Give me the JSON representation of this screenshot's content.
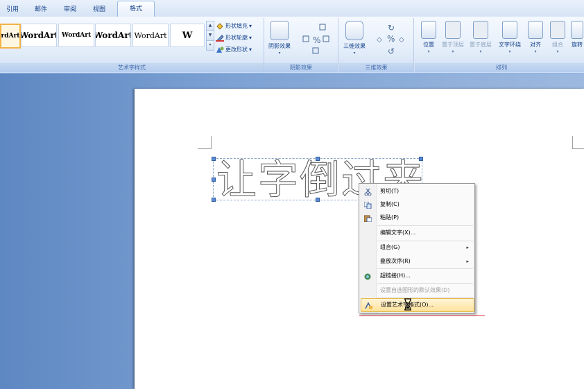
{
  "tabs": [
    {
      "label": "引用"
    },
    {
      "label": "邮件"
    },
    {
      "label": "审阅"
    },
    {
      "label": "视图"
    },
    {
      "label": "格式"
    }
  ],
  "ribbon": {
    "wordart_styles": {
      "swatches": [
        "rdArt",
        "WordArt",
        "WordArt",
        "WordArt",
        "WordArt",
        "W"
      ],
      "commands": [
        {
          "label": "形状填充",
          "arrow": "▾"
        },
        {
          "label": "形状轮廓",
          "arrow": "▾"
        },
        {
          "label": "更改形状",
          "arrow": "▾"
        }
      ],
      "group_label": "艺术字样式"
    },
    "shadow": {
      "button_label": "阴影效果",
      "group_label": "阴影效果"
    },
    "threed": {
      "button_label": "三维效果",
      "group_label": "三维效果"
    },
    "arrange": {
      "buttons": [
        {
          "label": "位置"
        },
        {
          "label": "置于顶层"
        },
        {
          "label": "置于底层"
        },
        {
          "label": "文字环绕"
        },
        {
          "label": "对齐"
        },
        {
          "label": "组合"
        },
        {
          "label": "旋转"
        }
      ],
      "group_label": "排列"
    }
  },
  "document": {
    "wordart_text": "让字倒过来"
  },
  "context_menu": {
    "items": [
      {
        "label": "剪切(T)",
        "icon": "scissors-icon",
        "disabled": false
      },
      {
        "label": "复制(C)",
        "icon": "copy-icon",
        "disabled": false
      },
      {
        "label": "粘贴(P)",
        "icon": "paste-icon",
        "disabled": false
      },
      {
        "label": "编辑文字(X)...",
        "icon": "",
        "disabled": false
      },
      {
        "label": "组合(G)",
        "icon": "",
        "disabled": false,
        "submenu": "▸"
      },
      {
        "label": "叠放次序(R)",
        "icon": "",
        "disabled": false,
        "submenu": "▸"
      },
      {
        "label": "超链接(H)...",
        "icon": "hyperlink-icon",
        "disabled": false
      },
      {
        "label": "设置自选图形的默认效果(D)",
        "icon": "",
        "disabled": true
      },
      {
        "label": "设置艺术字格式(O)...",
        "icon": "format-wordart-icon",
        "disabled": false,
        "highlighted": true
      }
    ]
  },
  "colors": {
    "ribbon_text": "#15428b",
    "highlight": "#ffe39b",
    "accent_line": "#d9323a"
  }
}
